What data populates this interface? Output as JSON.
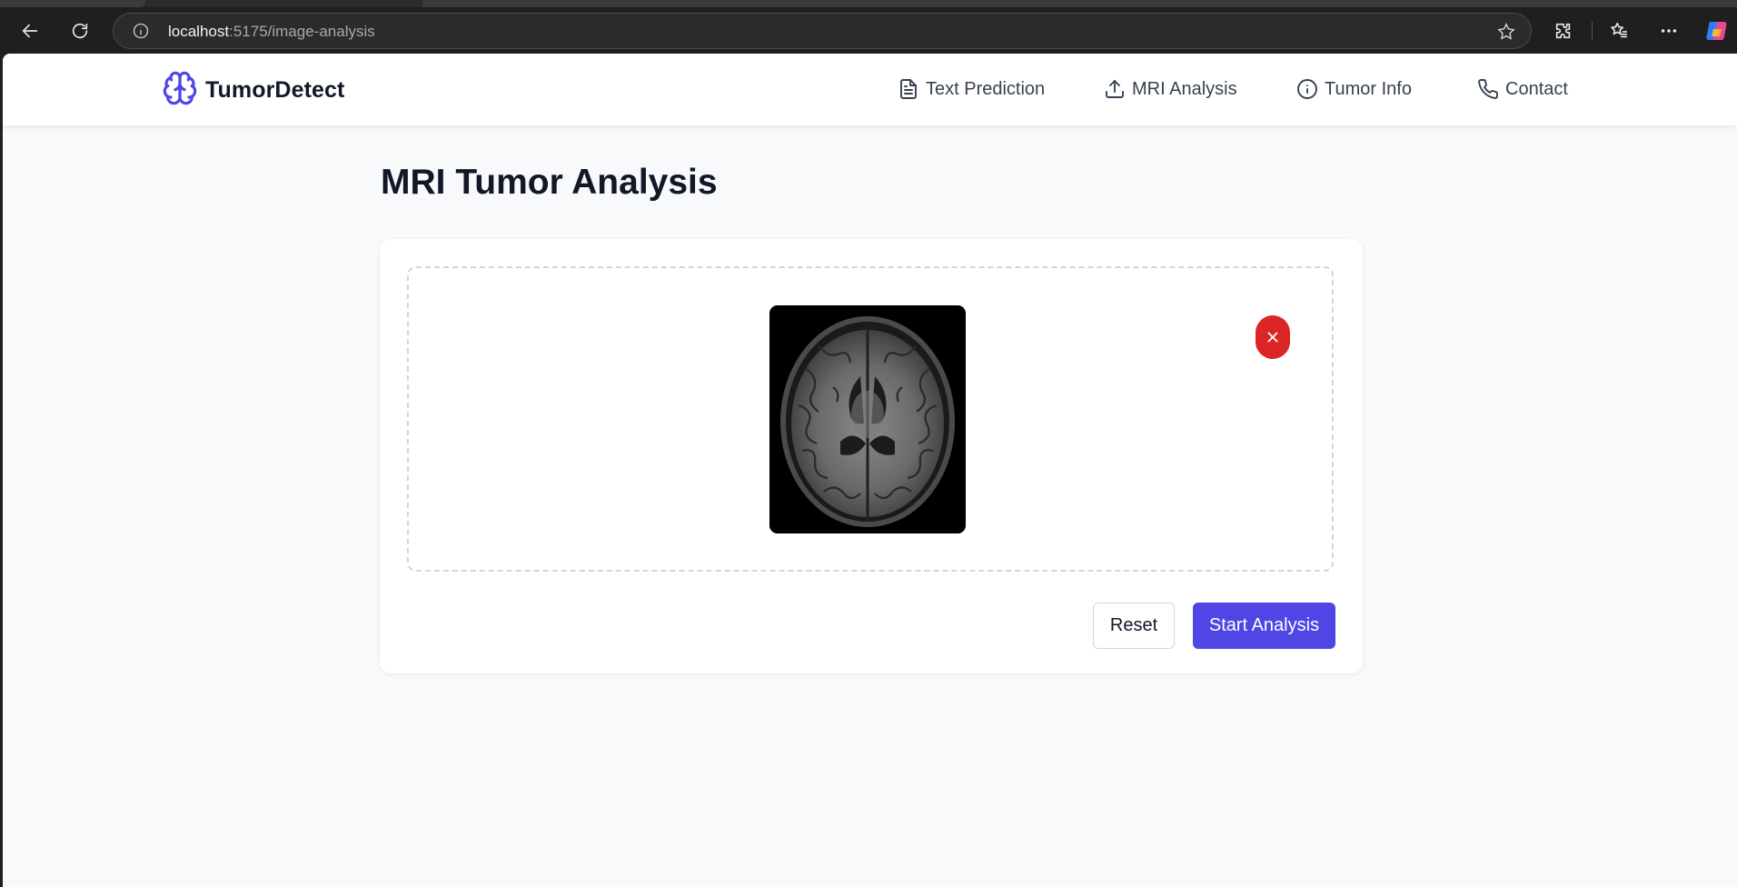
{
  "browser": {
    "url_host": "localhost",
    "url_path": ":5175/image-analysis"
  },
  "brand": {
    "name": "TumorDetect",
    "icon": "brain-icon",
    "accent_color": "#4f46e5"
  },
  "nav": {
    "items": [
      {
        "label": "Text Prediction",
        "icon": "file-text-icon"
      },
      {
        "label": "MRI Analysis",
        "icon": "upload-icon"
      },
      {
        "label": "Tumor Info",
        "icon": "info-icon"
      },
      {
        "label": "Contact",
        "icon": "phone-icon"
      }
    ]
  },
  "page": {
    "title": "MRI Tumor Analysis"
  },
  "upload": {
    "preview_icon": "mri-brain-scan",
    "remove_icon": "close-icon",
    "remove_color": "#dc2626"
  },
  "actions": {
    "reset_label": "Reset",
    "start_label": "Start Analysis"
  }
}
